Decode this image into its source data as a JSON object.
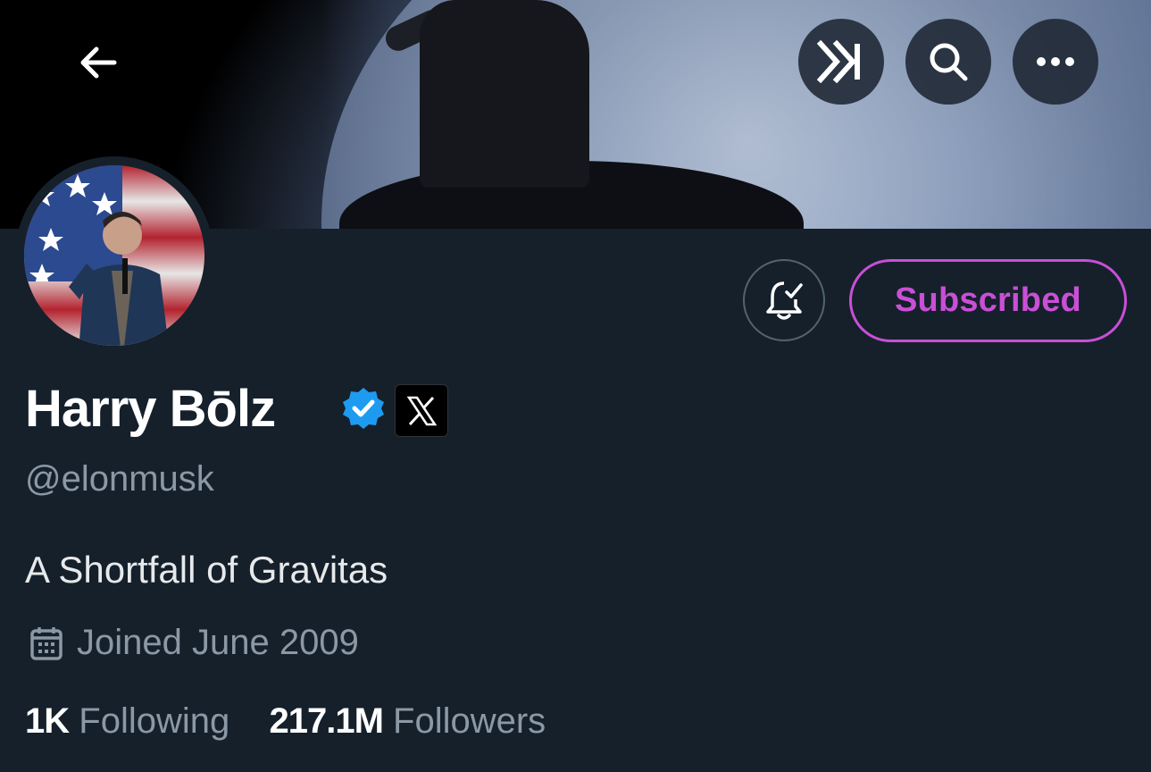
{
  "header": {
    "back_icon": "arrow-left-icon",
    "actions": [
      {
        "name": "xai-button",
        "icon": "xai-logo-icon",
        "logo_text": "xAI"
      },
      {
        "name": "search-button",
        "icon": "search-icon"
      },
      {
        "name": "more-button",
        "icon": "more-horizontal-icon"
      }
    ]
  },
  "profile": {
    "display_name": "Harry Bōlz",
    "handle": "@elonmusk",
    "bio": "A Shortfall of Gravitas",
    "joined": "Joined June 2009",
    "following_count": "1K",
    "following_label": "Following",
    "followers_count": "217.1M",
    "followers_label": "Followers"
  },
  "actions": {
    "subscribed_label": "Subscribed",
    "notification_icon": "bell-check-icon"
  },
  "colors": {
    "background": "#15202b",
    "accent_subscribed": "#c94fd6",
    "verified": "#1d9bf0",
    "muted_text": "#8b98a5"
  }
}
